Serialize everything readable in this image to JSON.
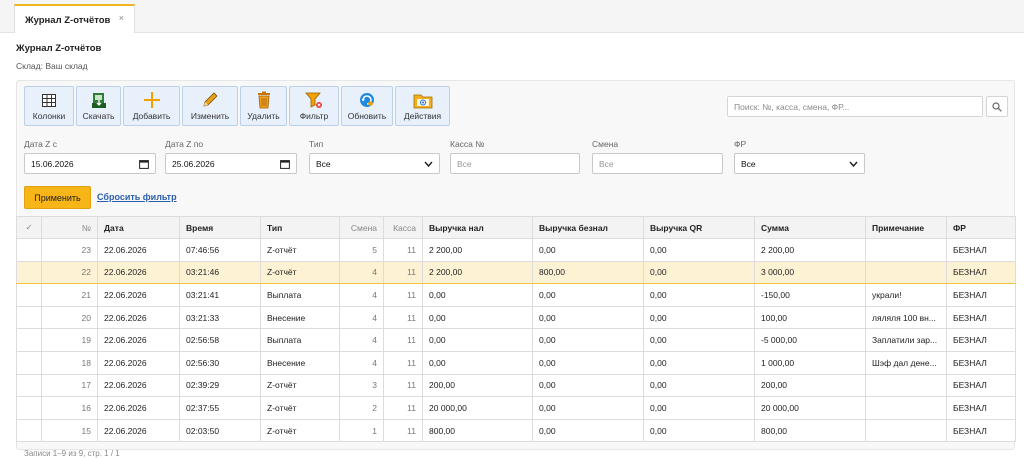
{
  "tab": {
    "label": "Журнал Z-отчётов",
    "close": "×"
  },
  "header": {
    "title": "Журнал Z-отчётов",
    "subtitle": "Склад: Ваш склад"
  },
  "toolbar": {
    "columns": "Колонки",
    "download": "Скачать",
    "add": "Добавить",
    "edit": "Изменить",
    "delete": "Удалить",
    "filter": "Фильтр",
    "refresh": "Обновить",
    "actions": "Действия"
  },
  "search": {
    "placeholder": "Поиск: №, касса, смена, ФР..."
  },
  "filters": {
    "date_from_label": "Дата Z с",
    "date_from": "15.06.2026",
    "date_to_label": "Дата Z по",
    "date_to": "25.06.2026",
    "type_label": "Тип",
    "type_value": "Все",
    "kassa_label": "Касса №",
    "kassa_placeholder": "Все",
    "shift_label": "Смена",
    "shift_placeholder": "Все",
    "fr_label": "ФР",
    "fr_value": "Все",
    "apply": "Применить",
    "reset": "Сбросить фильтр"
  },
  "table": {
    "columns": [
      "✓",
      "№",
      "Дата",
      "Время",
      "Тип",
      "Смена",
      "Касса",
      "Выручка нал",
      "Выручка безнал",
      "Выручка QR",
      "Сумма",
      "Примечание",
      "ФР"
    ],
    "rows": [
      {
        "n": "23",
        "date": "22.06.2026",
        "time": "07:46:56",
        "type": "Z-отчёт",
        "shift": "5",
        "kassa": "11",
        "cash": "2 200,00",
        "card": "0,00",
        "qr": "0,00",
        "sum": "2 200,00",
        "note": "",
        "fr": "БЕЗНАЛ",
        "selected": false
      },
      {
        "n": "22",
        "date": "22.06.2026",
        "time": "03:21:46",
        "type": "Z-отчёт",
        "shift": "4",
        "kassa": "11",
        "cash": "2 200,00",
        "card": "800,00",
        "qr": "0,00",
        "sum": "3 000,00",
        "note": "",
        "fr": "БЕЗНАЛ",
        "selected": true
      },
      {
        "n": "21",
        "date": "22.06.2026",
        "time": "03:21:41",
        "type": "Выплата",
        "shift": "4",
        "kassa": "11",
        "cash": "0,00",
        "card": "0,00",
        "qr": "0,00",
        "sum": "-150,00",
        "note": "украли!",
        "fr": "БЕЗНАЛ",
        "selected": false
      },
      {
        "n": "20",
        "date": "22.06.2026",
        "time": "03:21:33",
        "type": "Внесение",
        "shift": "4",
        "kassa": "11",
        "cash": "0,00",
        "card": "0,00",
        "qr": "0,00",
        "sum": "100,00",
        "note": "ляляля 100 вн...",
        "fr": "БЕЗНАЛ",
        "selected": false
      },
      {
        "n": "19",
        "date": "22.06.2026",
        "time": "02:56:58",
        "type": "Выплата",
        "shift": "4",
        "kassa": "11",
        "cash": "0,00",
        "card": "0,00",
        "qr": "0,00",
        "sum": "-5 000,00",
        "note": "Заплатили зар...",
        "fr": "БЕЗНАЛ",
        "selected": false
      },
      {
        "n": "18",
        "date": "22.06.2026",
        "time": "02:56:30",
        "type": "Внесение",
        "shift": "4",
        "kassa": "11",
        "cash": "0,00",
        "card": "0,00",
        "qr": "0,00",
        "sum": "1 000,00",
        "note": "Шэф дал дене...",
        "fr": "БЕЗНАЛ",
        "selected": false
      },
      {
        "n": "17",
        "date": "22.06.2026",
        "time": "02:39:29",
        "type": "Z-отчёт",
        "shift": "3",
        "kassa": "11",
        "cash": "200,00",
        "card": "0,00",
        "qr": "0,00",
        "sum": "200,00",
        "note": "",
        "fr": "БЕЗНАЛ",
        "selected": false
      },
      {
        "n": "16",
        "date": "22.06.2026",
        "time": "02:37:55",
        "type": "Z-отчёт",
        "shift": "2",
        "kassa": "11",
        "cash": "20 000,00",
        "card": "0,00",
        "qr": "0,00",
        "sum": "20 000,00",
        "note": "",
        "fr": "БЕЗНАЛ",
        "selected": false
      },
      {
        "n": "15",
        "date": "22.06.2026",
        "time": "02:03:50",
        "type": "Z-отчёт",
        "shift": "1",
        "kassa": "11",
        "cash": "800,00",
        "card": "0,00",
        "qr": "0,00",
        "sum": "800,00",
        "note": "",
        "fr": "БЕЗНАЛ",
        "selected": false
      }
    ]
  },
  "footer": {
    "text": "Записи 1–9 из 9, стр. 1 / 1"
  },
  "colors": {
    "accent": "#f7b518",
    "link": "#2a5ea8",
    "toolbar_bg": "#e7f0fb",
    "selected_row": "#fdf3d4"
  }
}
